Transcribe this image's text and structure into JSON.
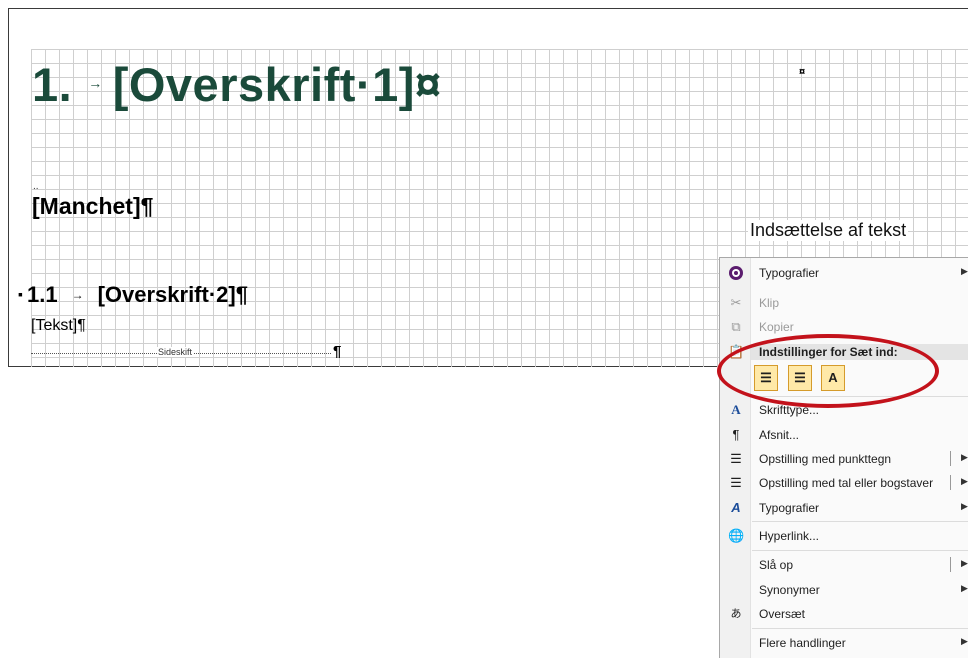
{
  "document": {
    "heading1_num": "1.",
    "heading1_text": "[Overskrift·1]¤",
    "cell_mark": "¤",
    "small_dots": "..",
    "manchet": "[Manchet]¶",
    "heading2_num": "1.1",
    "heading2_text": "[Overskrift·2]¶",
    "tekst": "[Tekst]¶",
    "pagebreak_label": "Sideskift",
    "pagebreak_pilcrow": "¶"
  },
  "annotation": "Indsættelse af tekst",
  "menu": {
    "items": [
      {
        "label": "Typografier",
        "icon": "typography-icon"
      },
      {
        "label": "Klip",
        "icon": "scissors-icon"
      },
      {
        "label": "Kopier",
        "icon": "copy-icon"
      },
      {
        "label": "Skrifttype...",
        "icon": "font-icon"
      },
      {
        "label": "Afsnit...",
        "icon": "paragraph-icon"
      },
      {
        "label": "Opstilling med punkttegn",
        "icon": "bullet-list-icon"
      },
      {
        "label": "Opstilling med tal eller bogstaver",
        "icon": "numbered-list-icon"
      },
      {
        "label": "Typografier",
        "icon": "styles-icon"
      },
      {
        "label": "Hyperlink...",
        "icon": "hyperlink-icon"
      },
      {
        "label": "Slå op",
        "icon": ""
      },
      {
        "label": "Synonymer",
        "icon": ""
      },
      {
        "label": "Oversæt",
        "icon": "translate-icon"
      },
      {
        "label": "Flere handlinger",
        "icon": ""
      }
    ],
    "paste_header": "Indstillinger for Sæt ind:",
    "paste_option_glyph": "A"
  },
  "colors": {
    "heading1": "#1a4a3a",
    "highlight_oval": "#c3121b",
    "paste_button_bg": "#ffe9a8"
  }
}
